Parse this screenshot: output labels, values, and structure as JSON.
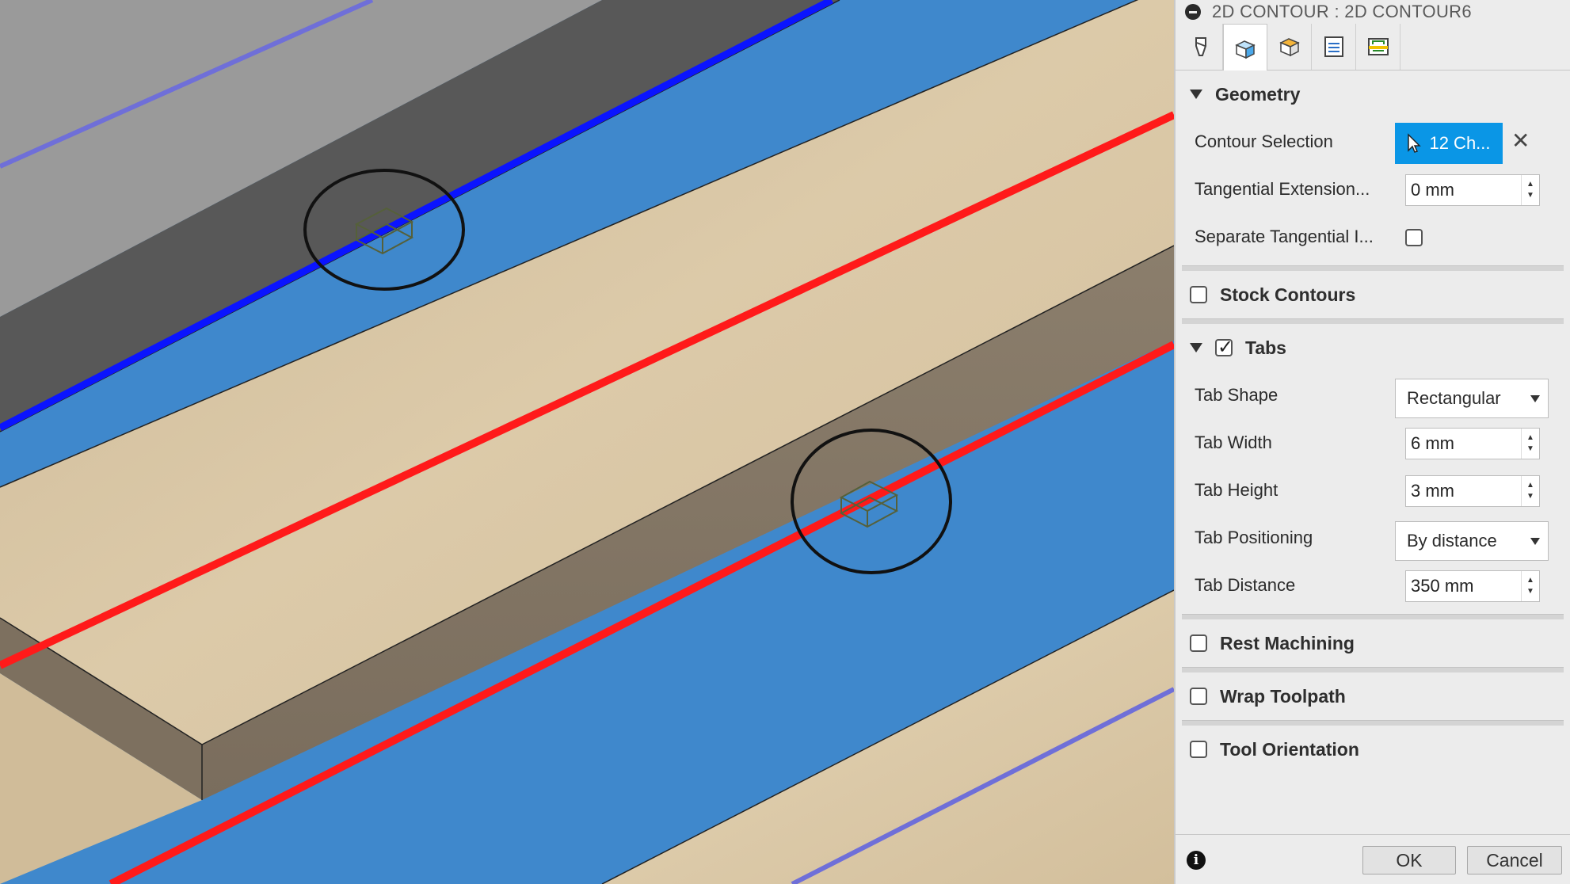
{
  "panel": {
    "title": "2D CONTOUR : 2D CONTOUR6",
    "tabs": [
      "tool-tab",
      "geometry-tab",
      "heights-tab",
      "passes-tab",
      "linking-tab"
    ],
    "geometry": {
      "header": "Geometry",
      "contour_selection_label": "Contour Selection",
      "contour_selection_value": "12 Ch...",
      "tangential_extension_label": "Tangential Extension...",
      "tangential_extension_value": "0 mm",
      "separate_tangential_label": "Separate Tangential I..."
    },
    "stock_contours": {
      "header": "Stock Contours",
      "checked": false
    },
    "tabs_section": {
      "header": "Tabs",
      "checked": true,
      "tab_shape_label": "Tab Shape",
      "tab_shape_value": "Rectangular",
      "tab_width_label": "Tab Width",
      "tab_width_value": "6 mm",
      "tab_height_label": "Tab Height",
      "tab_height_value": "3 mm",
      "tab_positioning_label": "Tab Positioning",
      "tab_positioning_value": "By distance",
      "tab_distance_label": "Tab Distance",
      "tab_distance_value": "350 mm"
    },
    "rest_machining": {
      "header": "Rest Machining",
      "checked": false
    },
    "wrap_toolpath": {
      "header": "Wrap Toolpath",
      "checked": false
    },
    "tool_orientation": {
      "header": "Tool Orientation",
      "checked": false
    },
    "footer": {
      "ok": "OK",
      "cancel": "Cancel"
    }
  },
  "colors": {
    "selection_button": "#0a96e6",
    "viewport_blue": "#3f88cc",
    "toolpath_red": "#ff1a1a",
    "toolpath_blue": "#0a14ff",
    "wood": "#d6c3a2"
  }
}
